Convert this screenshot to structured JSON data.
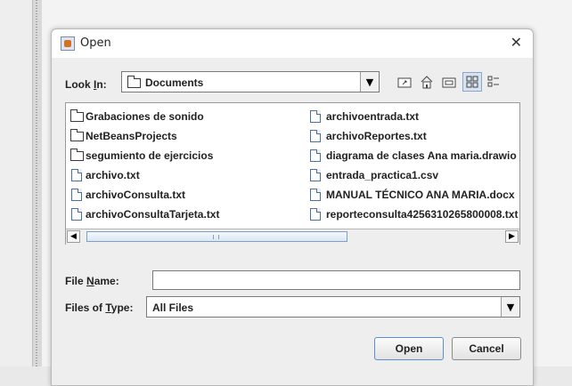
{
  "dialog": {
    "title": "Open",
    "close_glyph": "✕",
    "app_icon": "java-cup-icon"
  },
  "look_in": {
    "label_pre": "Look ",
    "label_mnemonic": "I",
    "label_post": "n:",
    "value": "Documents",
    "icon": "folder-icon"
  },
  "toolbar": {
    "buttons": [
      "up-one-level-icon",
      "home-icon",
      "new-folder-icon",
      "list-view-icon",
      "details-view-icon"
    ],
    "selected": "list-view-icon"
  },
  "files": {
    "column1": [
      {
        "name": "Grabaciones de sonido",
        "type": "folder"
      },
      {
        "name": "NetBeansProjects",
        "type": "folder"
      },
      {
        "name": "segumiento de ejercicios",
        "type": "folder"
      },
      {
        "name": "archivo.txt",
        "type": "file"
      },
      {
        "name": "archivoConsulta.txt",
        "type": "file"
      },
      {
        "name": "archivoConsultaTarjeta.txt",
        "type": "file"
      }
    ],
    "column2": [
      {
        "name": "archivoentrada.txt",
        "type": "file"
      },
      {
        "name": "archivoReportes.txt",
        "type": "file"
      },
      {
        "name": "diagrama de clases Ana maria.drawio",
        "type": "file"
      },
      {
        "name": "entrada_practica1.csv",
        "type": "file"
      },
      {
        "name": "MANUAL TÉCNICO ANA MARIA.docx",
        "type": "file"
      },
      {
        "name": "reporteconsulta4256310265800008.txt",
        "type": "file"
      }
    ]
  },
  "file_name": {
    "label_pre": "File ",
    "label_mnemonic": "N",
    "label_post": "ame:",
    "value": ""
  },
  "files_of_type": {
    "label_pre": "Files of ",
    "label_mnemonic": "T",
    "label_post": "ype:",
    "value": "All Files"
  },
  "buttons": {
    "open": "Open",
    "cancel": "Cancel"
  }
}
